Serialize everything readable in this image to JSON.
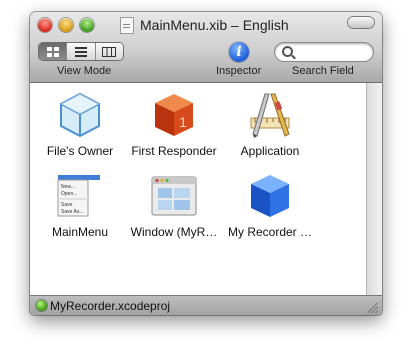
{
  "window": {
    "title": "MainMenu.xib – English"
  },
  "toolbar": {
    "view_mode_label": "View Mode",
    "inspector_label": "Inspector",
    "search_label": "Search Field",
    "inspector_glyph": "i",
    "search_placeholder": ""
  },
  "items": [
    {
      "label": "File's Owner",
      "icon": "cube-outline-icon"
    },
    {
      "label": "First Responder",
      "icon": "first-responder-cube-icon"
    },
    {
      "label": "Application",
      "icon": "application-icon"
    },
    {
      "label": "MainMenu",
      "icon": "menu-icon"
    },
    {
      "label": "Window (MyR…",
      "icon": "window-icon"
    },
    {
      "label": "My Recorder …",
      "icon": "blue-cube-icon"
    }
  ],
  "statusbar": {
    "project": "MyRecorder.xcodeproj"
  },
  "colors": {
    "accent_blue": "#1f5fd6",
    "responder_orange": "#d74a1c",
    "status_green": "#3c9c10"
  }
}
